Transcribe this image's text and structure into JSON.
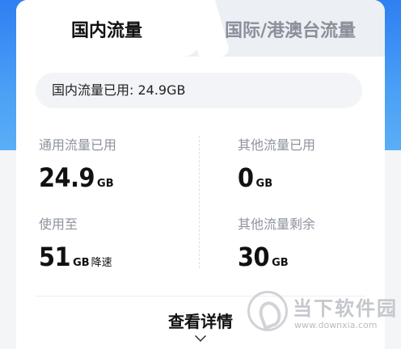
{
  "tabs": {
    "domestic": "国内流量",
    "international": "国际/港澳台流量"
  },
  "summary": "国内流量已用: 24.9GB",
  "stats": {
    "general_used": {
      "label": "通用流量已用",
      "value": "24.9",
      "unit": "GB"
    },
    "other_used": {
      "label": "其他流量已用",
      "value": "0",
      "unit": "GB"
    },
    "throttle_at": {
      "label": "使用至",
      "value": "51",
      "unit": "GB",
      "suffix": "降速"
    },
    "other_remaining": {
      "label": "其他流量剩余",
      "value": "30",
      "unit": "GB"
    }
  },
  "details": {
    "label": "查看详情",
    "icon": "chevron-down-icon"
  },
  "watermark": {
    "title": "当下软件园",
    "url": "www.downxia.com"
  },
  "colors": {
    "header_blue": "#2f7ff2",
    "tab_inactive_bg": "#eceff3",
    "summary_bg": "#f2f4f8"
  }
}
